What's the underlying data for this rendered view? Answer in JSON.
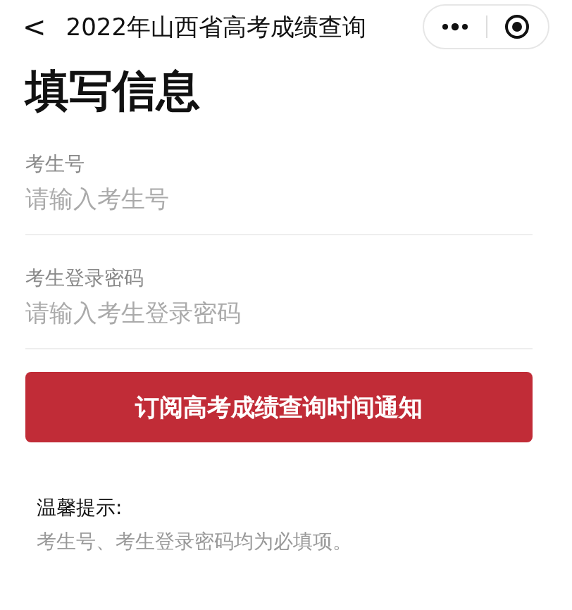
{
  "nav_bar": {
    "back": "<",
    "title": "2022年山西省高考成绩查询"
  },
  "heading": "填写信息",
  "fields": [
    {
      "label": "考生号",
      "placeholder": "请输入考生号"
    },
    {
      "label": "考生登录密码",
      "placeholder": "请输入考生登录密码"
    }
  ],
  "submit_button": "订阅高考成绩查询时间通知",
  "tip": {
    "title": "温馨提示:",
    "text": "考生号、考生登录密码均为必填项。"
  }
}
